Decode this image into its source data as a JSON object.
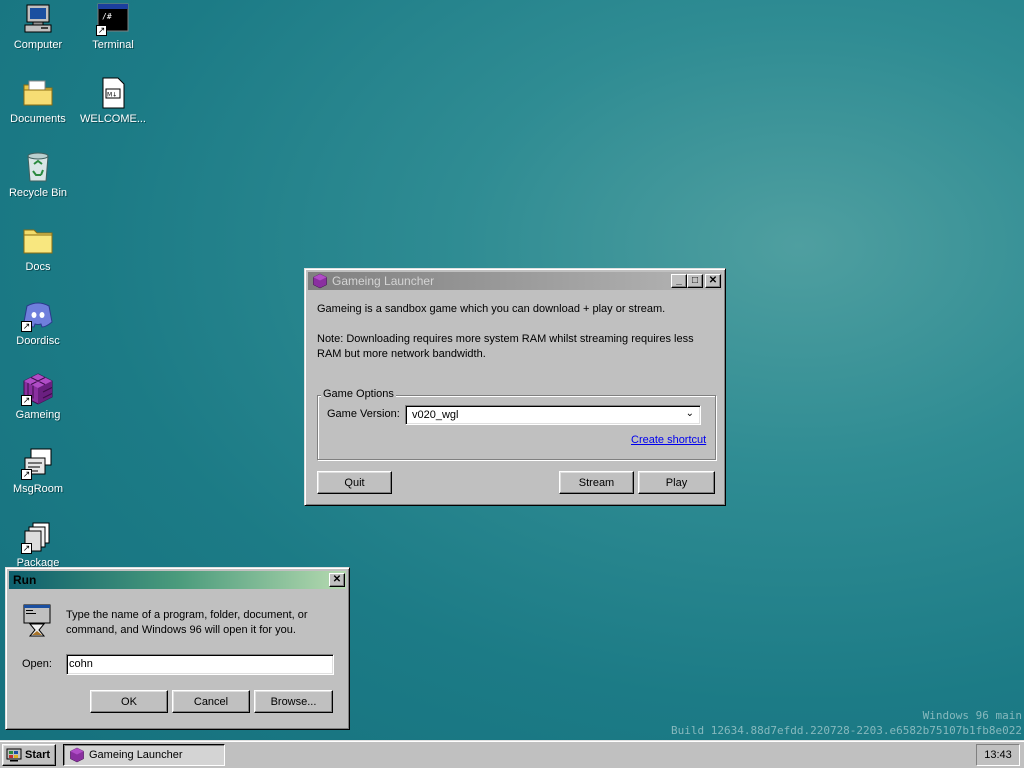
{
  "desktop": {
    "icons": [
      {
        "label": "Computer",
        "icon": "computer-icon"
      },
      {
        "label": "Terminal",
        "icon": "terminal-icon"
      },
      {
        "label": "Documents",
        "icon": "documents-folder-icon"
      },
      {
        "label": "WELCOME...",
        "icon": "markdown-file-icon"
      },
      {
        "label": "Recycle Bin",
        "icon": "recycle-bin-icon"
      },
      {
        "label": "Docs",
        "icon": "folder-icon"
      },
      {
        "label": "Doordisc",
        "icon": "doordisc-icon"
      },
      {
        "label": "Gameing",
        "icon": "gameing-cube-icon"
      },
      {
        "label": "MsgRoom",
        "icon": "msgroom-icon"
      },
      {
        "label": "Package",
        "icon": "package-icon"
      }
    ],
    "terminal_glyph": "/#",
    "md_glyph": "M↓",
    "watermark_line1": "Windows 96 main",
    "watermark_line2": "Build 12634.88d7efdd.220728-2203.e6582b75107b1fb8e022"
  },
  "launcher": {
    "title": "Gameing Launcher",
    "description": "Gameing is a sandbox game which you can download + play or stream.",
    "note": "Note: Downloading requires more system RAM whilst streaming requires less RAM but more network bandwidth.",
    "group_label": "Game Options",
    "version_label": "Game Version:",
    "version_value": "v020_wgl",
    "shortcut_link": "Create shortcut",
    "quit_label": "Quit",
    "stream_label": "Stream",
    "play_label": "Play"
  },
  "run_dialog": {
    "title": "Run",
    "description": "Type the name of a program, folder, document, or command, and Windows 96 will open it for you.",
    "open_label": "Open:",
    "open_value": "cohn",
    "ok_label": "OK",
    "cancel_label": "Cancel",
    "browse_label": "Browse..."
  },
  "taskbar": {
    "start_label": "Start",
    "task_label": "Gameing Launcher",
    "clock": "13:43"
  },
  "colors": {
    "desktop": "#1c7b86",
    "face": "#c0c0c0",
    "active_title": "#0a6a78",
    "gameing_purple": "#7b2d8e"
  }
}
